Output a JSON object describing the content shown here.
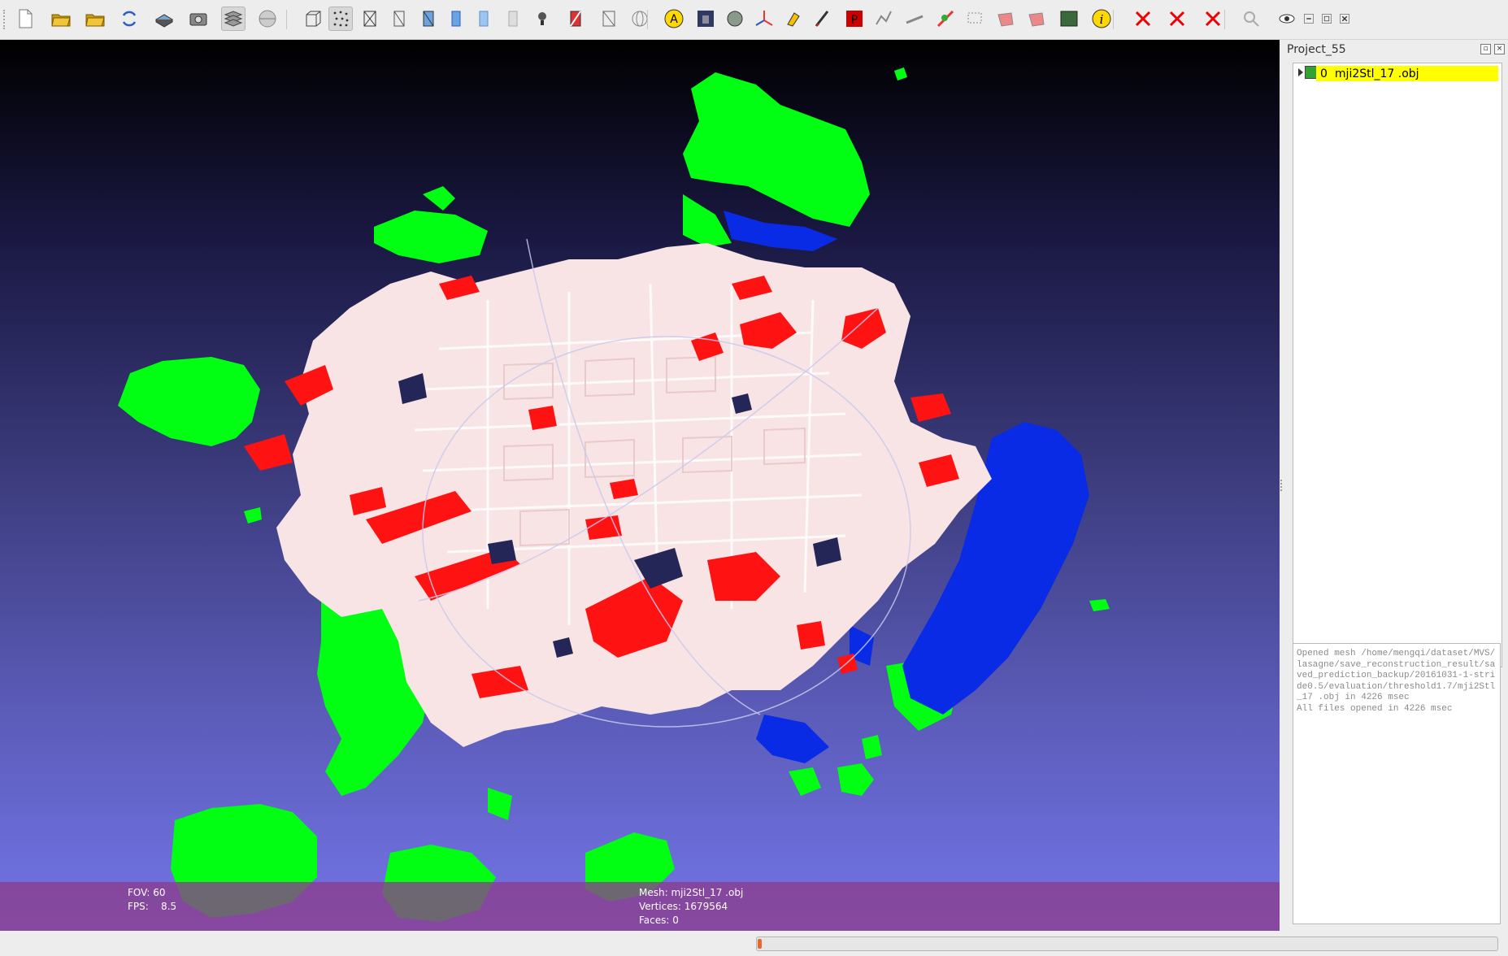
{
  "toolbar": {
    "buttons": [
      {
        "id": "new",
        "icon": "new-file-icon"
      },
      {
        "id": "open",
        "icon": "open-folder-icon"
      },
      {
        "id": "import",
        "icon": "import-folder-icon"
      },
      {
        "id": "reload",
        "icon": "reload-icon"
      },
      {
        "id": "save",
        "icon": "save-icon"
      },
      {
        "id": "snapshot",
        "icon": "camera-icon"
      },
      {
        "id": "layers",
        "icon": "layers-icon"
      },
      {
        "id": "light",
        "icon": "sphere-icon"
      },
      {
        "id": "bbox",
        "icon": "bbox-icon"
      },
      {
        "id": "points",
        "icon": "points-icon"
      },
      {
        "id": "wire",
        "icon": "wireframe-icon"
      },
      {
        "id": "hidden",
        "icon": "hidden-lines-icon"
      },
      {
        "id": "flatlines",
        "icon": "flat-lines-icon"
      },
      {
        "id": "flat",
        "icon": "flat-icon"
      },
      {
        "id": "smooth",
        "icon": "smooth-icon"
      },
      {
        "id": "texture",
        "icon": "texture-icon"
      },
      {
        "id": "lamp",
        "icon": "lamp-icon"
      },
      {
        "id": "colorize",
        "icon": "colorize-icon"
      },
      {
        "id": "select_faces",
        "icon": "select-faces-icon"
      },
      {
        "id": "trackball",
        "icon": "trackball-icon"
      },
      {
        "id": "annotate",
        "icon": "annotate-icon"
      },
      {
        "id": "render",
        "icon": "render-icon"
      },
      {
        "id": "decorate",
        "icon": "decorate-icon"
      },
      {
        "id": "axes",
        "icon": "axes-icon"
      },
      {
        "id": "paint",
        "icon": "paint-icon"
      },
      {
        "id": "brush",
        "icon": "brush-icon"
      },
      {
        "id": "pickpoints",
        "icon": "pick-points-icon"
      },
      {
        "id": "align",
        "icon": "align-icon"
      },
      {
        "id": "measure",
        "icon": "measure-icon"
      },
      {
        "id": "raster",
        "icon": "raster-icon"
      },
      {
        "id": "select_rect",
        "icon": "select-rect-icon"
      },
      {
        "id": "select_vertices",
        "icon": "select-vertices-icon"
      },
      {
        "id": "select_conn",
        "icon": "select-connected-icon"
      },
      {
        "id": "image",
        "icon": "image-icon"
      },
      {
        "id": "info",
        "icon": "info-icon"
      },
      {
        "id": "del_faces",
        "icon": "delete-faces-icon"
      },
      {
        "id": "del_faces_vertices",
        "icon": "delete-faces-vertices-icon"
      },
      {
        "id": "del_vertices",
        "icon": "delete-vertices-icon"
      },
      {
        "id": "zoom",
        "icon": "magnifier-icon"
      },
      {
        "id": "eye",
        "icon": "eye-icon"
      },
      {
        "id": "win_min",
        "icon": "minimize-icon"
      },
      {
        "id": "win_restore",
        "icon": "restore-icon"
      },
      {
        "id": "win_close",
        "icon": "close-icon"
      }
    ]
  },
  "viewport": {
    "info_left": [
      "FOV: 60",
      "FPS:    8.5"
    ],
    "info_right": [
      "Mesh: mji2Stl_17 .obj",
      "Vertices: 1679564",
      "Faces: 0"
    ]
  },
  "panel": {
    "title": "Project_55",
    "layer": {
      "index": "0",
      "name": "mji2Stl_17 .obj"
    },
    "log": [
      "Opened mesh /home/mengqi/dataset/MVS/lasagne/save_reconstruction_result/saved_prediction_backup/20161031-1-stride0.5/evaluation/threshold1.7/mji2Stl_17 .obj in 4226 msec",
      "All files opened in 4226 msec"
    ]
  },
  "status": {
    "progress_fraction": 0.005
  },
  "colors": {
    "mesh_white": "#f8e4e4",
    "mesh_red": "#ff1212",
    "mesh_green": "#00ff12",
    "mesh_blue": "#0a2be6",
    "layer_highlight": "#ffff00"
  }
}
